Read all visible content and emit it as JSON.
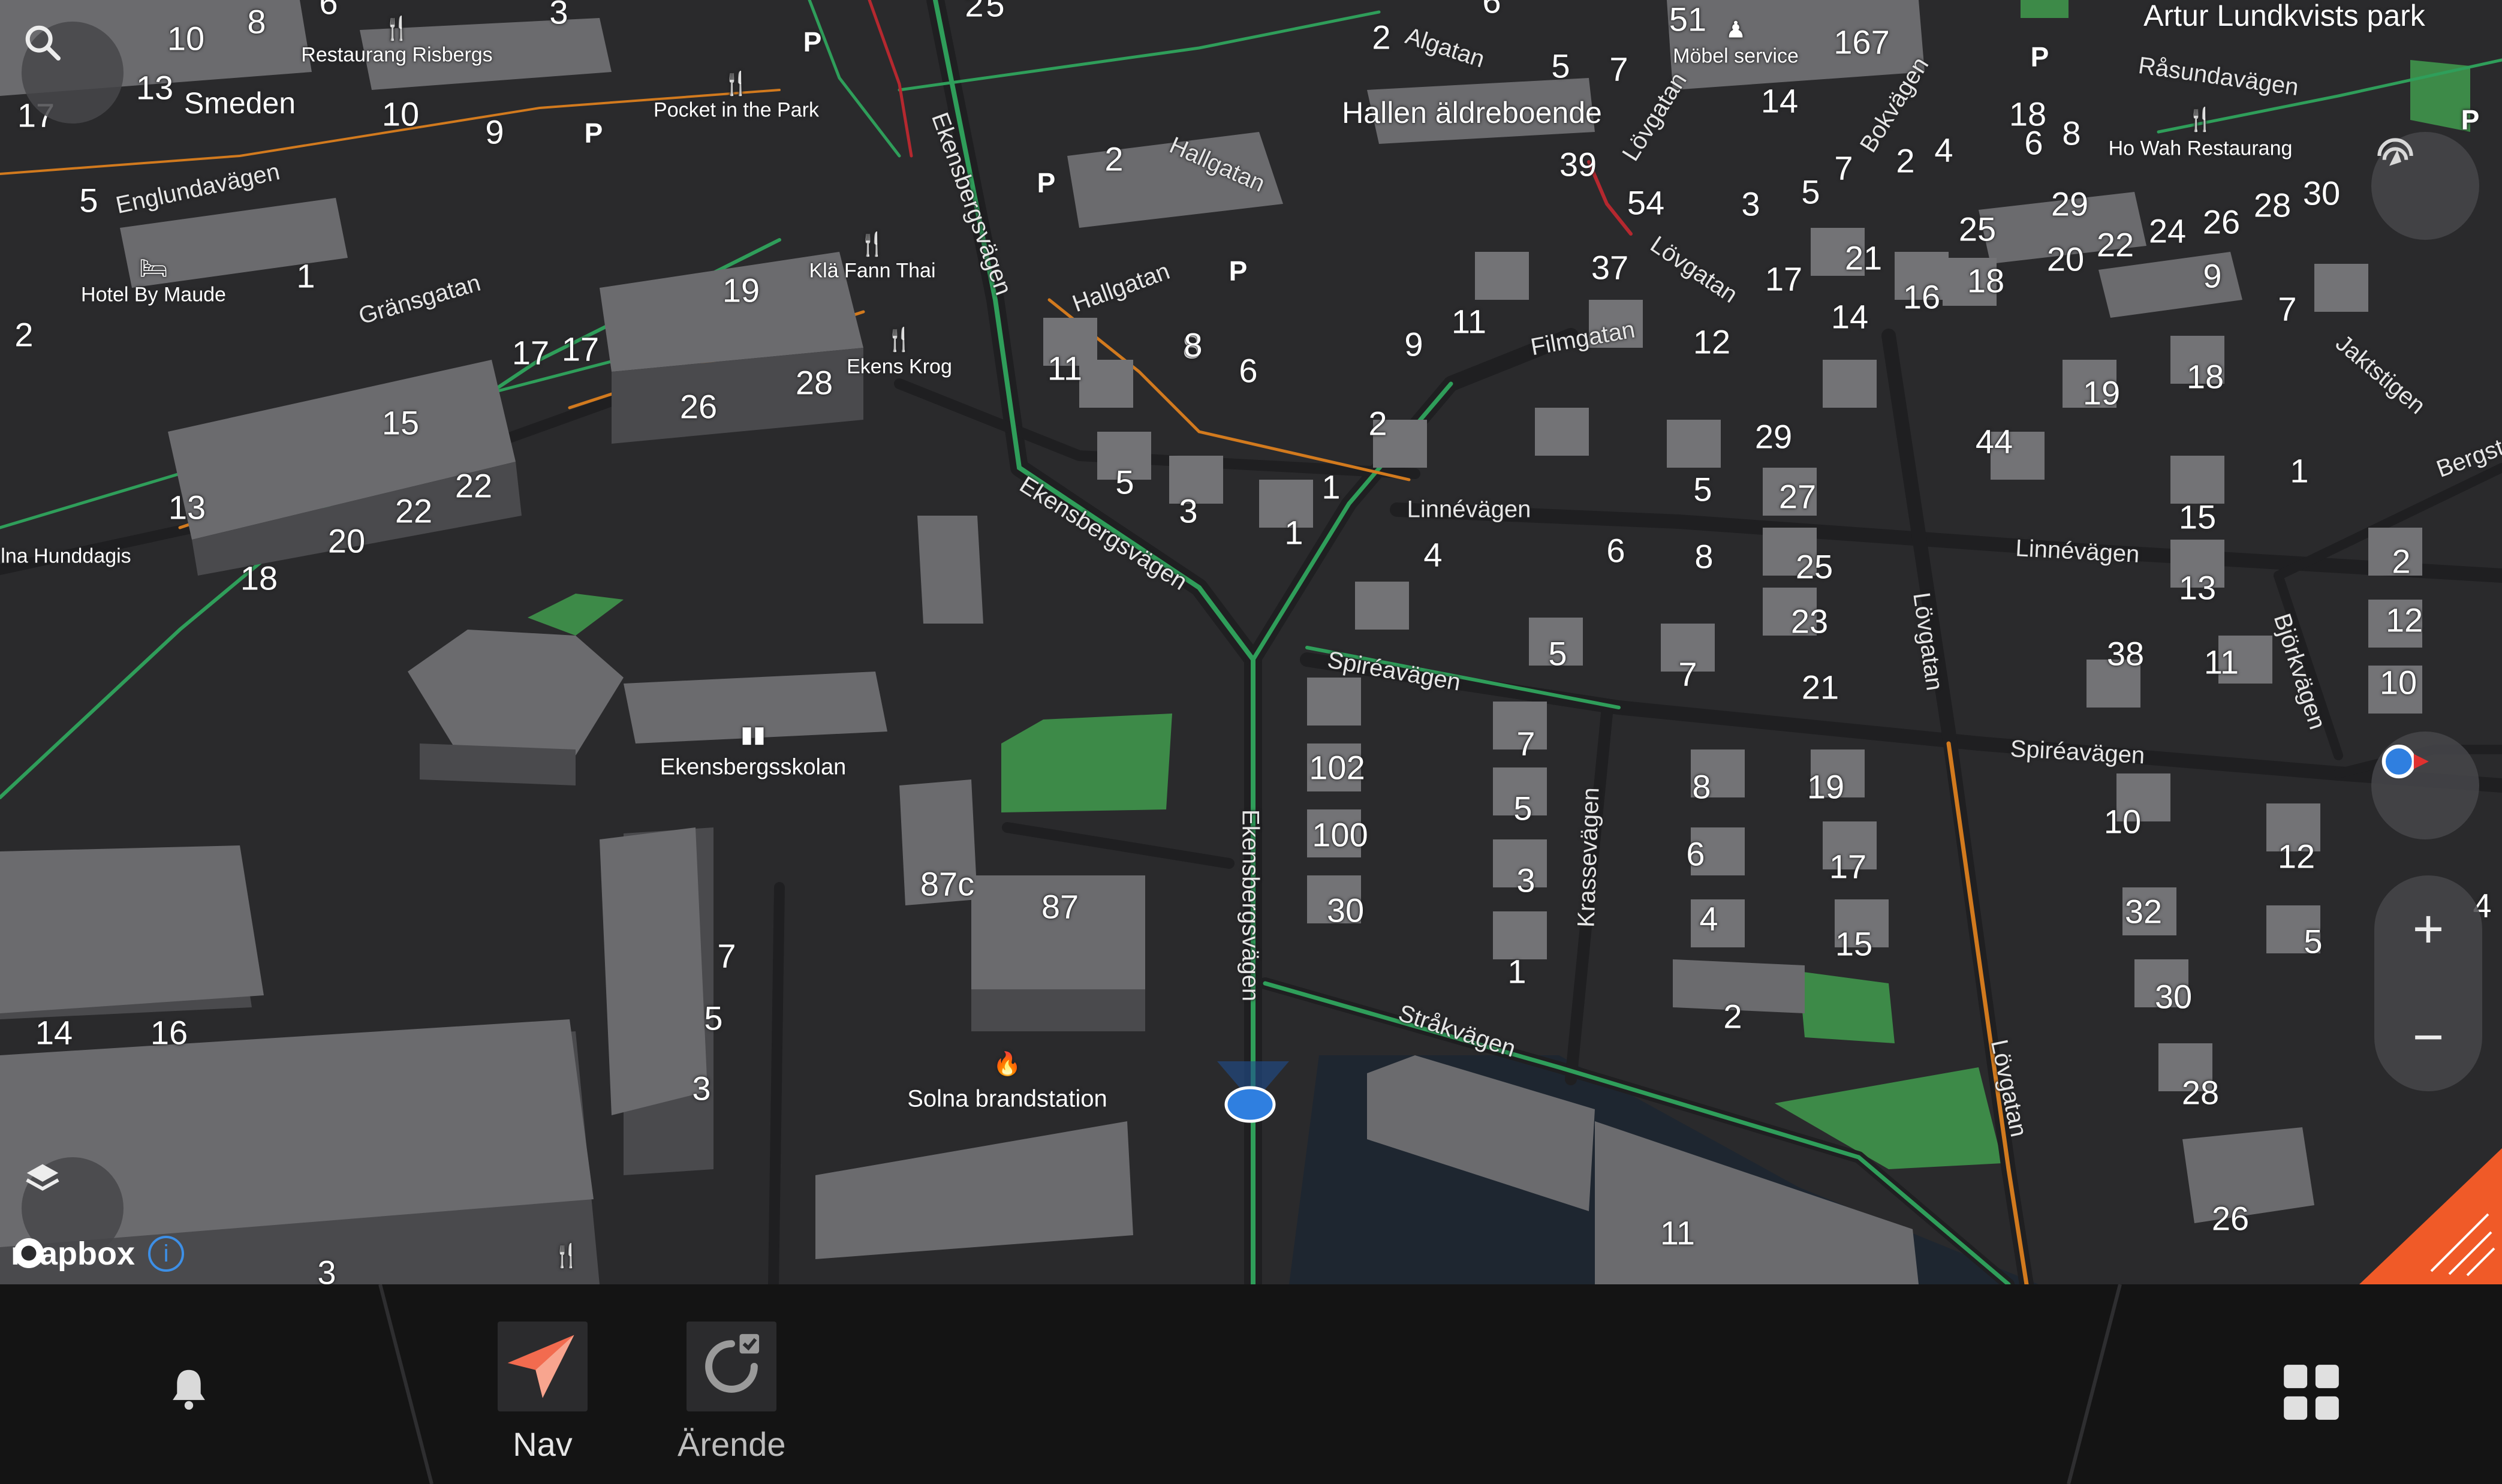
{
  "map": {
    "attribution": "mapbox",
    "place_labels": [
      {
        "text": "Artur Lundkvists park"
      },
      {
        "text": "Hallen äldreboende"
      },
      {
        "text": "Smeden"
      },
      {
        "text": "Ekensbergsskolan"
      },
      {
        "text": "Solna brandstation"
      }
    ],
    "poi_labels": [
      {
        "text": "Restaurang Risbergs"
      },
      {
        "text": "Pocket in the Park"
      },
      {
        "text": "Hotel By Maude"
      },
      {
        "text": "Klä Fann Thai"
      },
      {
        "text": "Ekens Krog"
      },
      {
        "text": "Ho Wah Restaurang"
      },
      {
        "text": "Möbel service"
      },
      {
        "text": "lna Hunddagis"
      }
    ],
    "street_labels": [
      {
        "text": "Englundavägen"
      },
      {
        "text": "Gränsgatan"
      },
      {
        "text": "Ekensbergsvägen"
      },
      {
        "text": "Hallgatan"
      },
      {
        "text": "Algatan"
      },
      {
        "text": "Lövgatan"
      },
      {
        "text": "Bokvägen"
      },
      {
        "text": "Råsundavägen"
      },
      {
        "text": "Filmgatan"
      },
      {
        "text": "Linnévägen"
      },
      {
        "text": "Spiréavägen"
      },
      {
        "text": "Krassevägen"
      },
      {
        "text": "Stråkvägen"
      },
      {
        "text": "Björkvägen"
      },
      {
        "text": "Jaktstigen"
      },
      {
        "text": "Bergst"
      }
    ],
    "house_numbers": [
      "10",
      "8",
      "6",
      "3",
      "13",
      "17",
      "10",
      "9",
      "5",
      "1",
      "19",
      "2",
      "17",
      "17",
      "15",
      "26",
      "28",
      "22",
      "22",
      "13",
      "20",
      "18",
      "14",
      "16",
      "7",
      "5",
      "3",
      "3",
      "87c",
      "87",
      "102",
      "100",
      "30",
      "7",
      "5",
      "3",
      "1",
      "11",
      "6",
      "8",
      "5",
      "3",
      "1",
      "1",
      "9",
      "11",
      "8",
      "2",
      "12",
      "29",
      "5",
      "27",
      "4",
      "6",
      "8",
      "25",
      "23",
      "21",
      "5",
      "7",
      "8",
      "19",
      "6",
      "17",
      "4",
      "15",
      "2",
      "11",
      "51",
      "167",
      "14",
      "39",
      "54",
      "3",
      "5",
      "7",
      "2",
      "4",
      "6",
      "8",
      "37",
      "17",
      "21",
      "14",
      "16",
      "18",
      "25",
      "20",
      "22",
      "29",
      "24",
      "26",
      "28",
      "30",
      "9",
      "7",
      "19",
      "18",
      "44",
      "1",
      "15",
      "13",
      "38",
      "11",
      "2",
      "12",
      "10",
      "10",
      "12",
      "32",
      "30",
      "5",
      "28",
      "26",
      "4",
      "2",
      "5",
      "6",
      "2",
      "5",
      "7",
      "18",
      "2"
    ]
  },
  "controls": {
    "search_icon": "search-icon",
    "layers_icon": "layers-icon",
    "recenter_icon": "recenter-icon",
    "compass_icon": "compass-icon",
    "zoom_in": "+",
    "zoom_out": "−",
    "info_icon": "i"
  },
  "bottom_bar": {
    "notifications_icon": "bell-icon",
    "tabs": [
      {
        "label": "Nav",
        "icon": "navigation-arrow-icon"
      },
      {
        "label": "Ärende",
        "icon": "task-refresh-icon"
      }
    ],
    "apps_icon": "grid-icon"
  },
  "colors": {
    "map_background": "#2a2a2c",
    "building_top": "#6b6b6e",
    "green_route": "#2f9e5a",
    "orange_route": "#d27a1e",
    "nav_accent": "#f26b4f",
    "location_dot": "#2f7fe0",
    "corner_accent": "#f05a28"
  }
}
